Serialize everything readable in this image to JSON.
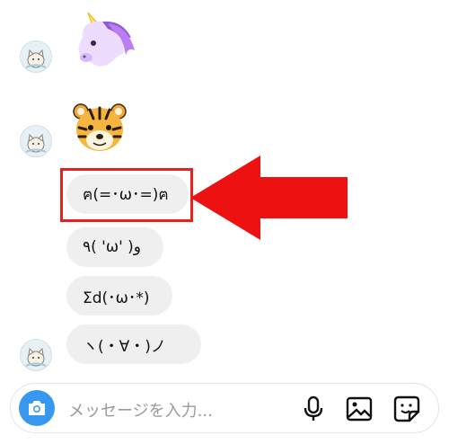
{
  "conversation": {
    "emoji_messages": [
      {
        "icon": "unicorn-face-emoji"
      },
      {
        "icon": "tiger-face-emoji"
      }
    ],
    "text_messages": [
      "ฅ(=･ω･=)ฅ",
      "٩( 'ω' )و",
      "Σd(･ω･*)",
      "ヽ(・∀・)ノ"
    ],
    "avatar_icon": "cat-avatar-icon",
    "highlighted_index": 0
  },
  "annotation": {
    "highlight_color": "#e8201f",
    "arrow_color": "#ee1111",
    "arrow_icon": "left-arrow-icon"
  },
  "composer": {
    "placeholder": "メッセージを入力...",
    "camera_icon": "camera-icon",
    "tools": [
      "microphone-icon",
      "image-gallery-icon",
      "sticker-icon"
    ],
    "accent_color": "#3897f0"
  }
}
